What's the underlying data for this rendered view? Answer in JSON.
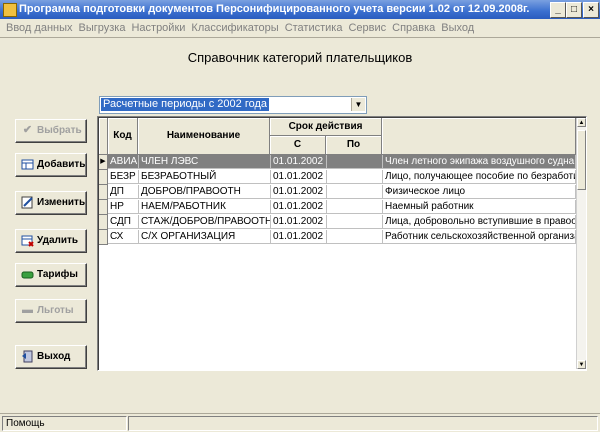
{
  "window": {
    "title": "Программа подготовки документов Персонифицированного учета версии 1.02 от 12.09.2008г.",
    "buttons": [
      "minimize",
      "maximize",
      "close"
    ]
  },
  "menu": [
    "Ввод данных",
    "Выгрузка",
    "Настройки",
    "Классификаторы",
    "Статистика",
    "Сервис",
    "Справка",
    "Выход"
  ],
  "heading": "Справочник категорий плательщиков",
  "period_select": {
    "value": "Расчетные периоды с 2002 года"
  },
  "actions": [
    {
      "label": "Выбрать",
      "icon": "check-icon",
      "enabled": false
    },
    {
      "label": "Добавить",
      "icon": "add-record-icon",
      "enabled": true
    },
    {
      "label": "Изменить",
      "icon": "edit-icon",
      "enabled": true
    },
    {
      "label": "Удалить",
      "icon": "delete-icon",
      "enabled": true
    },
    {
      "label": "Тарифы",
      "icon": "money-icon",
      "enabled": true
    },
    {
      "label": "Льготы",
      "icon": "minus-icon",
      "enabled": false
    },
    {
      "label": "Выход",
      "icon": "exit-door-icon",
      "enabled": true
    }
  ],
  "table": {
    "headers": {
      "code": "Код",
      "name": "Наименование",
      "validity": "Срок действия",
      "from": "С",
      "to": "По"
    },
    "rows": [
      {
        "code": "АВИА",
        "name": "ЧЛЕН ЛЭВС",
        "from": "01.01.2002",
        "to": "",
        "desc": "Член летного экипажа воздушного судна гр",
        "selected": true
      },
      {
        "code": "БЕЗР",
        "name": "БЕЗРАБОТНЫЙ",
        "from": "01.01.2002",
        "to": "",
        "desc": "Лицо, получающее пособие по безработице",
        "selected": false
      },
      {
        "code": "ДП",
        "name": "ДОБРОВ/ПРАВООТН",
        "from": "01.01.2002",
        "to": "",
        "desc": "Физическое лицо",
        "selected": false
      },
      {
        "code": "НР",
        "name": "НАЕМ/РАБОТНИК",
        "from": "01.01.2002",
        "to": "",
        "desc": "Наемный работник",
        "selected": false
      },
      {
        "code": "СДП",
        "name": "СТАЖ/ДОБРОВ/ПРАВООТН",
        "from": "01.01.2002",
        "to": "",
        "desc": "Лица, добровольно вступившие в правоотн",
        "selected": false
      },
      {
        "code": "СХ",
        "name": "С/Х ОРГАНИЗАЦИЯ",
        "from": "01.01.2002",
        "to": "",
        "desc": "Работник сельскохозяйственной организа",
        "selected": false
      }
    ]
  },
  "status": {
    "text": "Помощь"
  }
}
